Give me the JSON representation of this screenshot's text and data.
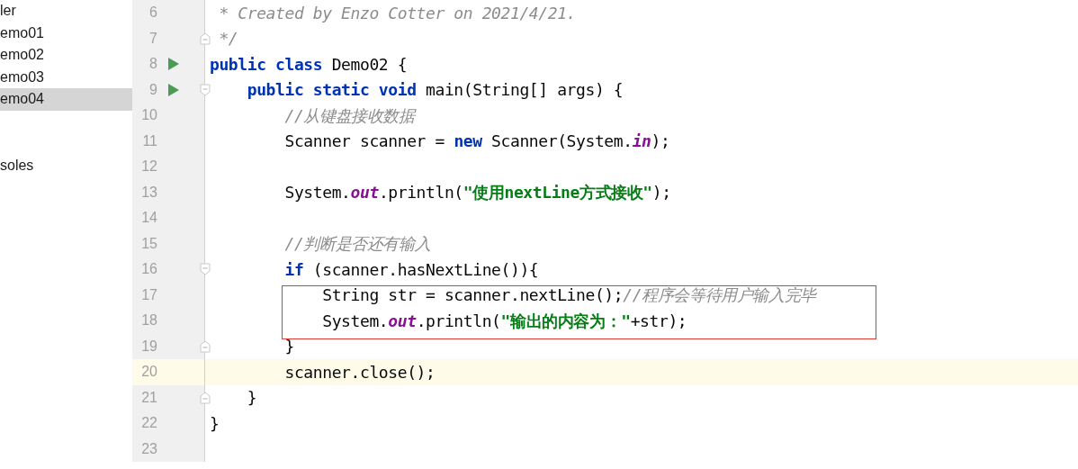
{
  "sidebar": {
    "items": [
      {
        "label": "ler",
        "selected": false
      },
      {
        "label": "emo01",
        "selected": false
      },
      {
        "label": "emo02",
        "selected": false
      },
      {
        "label": "emo03",
        "selected": false
      },
      {
        "label": "emo04",
        "selected": true
      },
      {
        "selected": false
      },
      {
        "selected": false
      },
      {
        "label": "soles",
        "selected": false
      }
    ]
  },
  "editor": {
    "lines": [
      {
        "number": "6",
        "run": false,
        "fold_start": false,
        "fold_end": false,
        "current": false,
        "boxed": false,
        "segments": [
          {
            "kind": "comment",
            "text": " * Created by Enzo Cotter on 2021/4/21."
          }
        ]
      },
      {
        "number": "7",
        "run": false,
        "fold_start": false,
        "fold_end": true,
        "current": false,
        "boxed": false,
        "segments": [
          {
            "kind": "comment",
            "text": " */"
          }
        ]
      },
      {
        "number": "8",
        "run": true,
        "fold_start": false,
        "fold_end": false,
        "current": false,
        "boxed": false,
        "segments": [
          {
            "kind": "keyword",
            "text": "public class"
          },
          {
            "kind": "plain",
            "text": " Demo02 {"
          }
        ]
      },
      {
        "number": "9",
        "run": true,
        "fold_start": true,
        "fold_end": false,
        "current": false,
        "boxed": false,
        "segments": [
          {
            "kind": "keyword",
            "text": "    public static void"
          },
          {
            "kind": "plain",
            "text": " main(String[] args) {"
          }
        ]
      },
      {
        "number": "10",
        "run": false,
        "fold_start": false,
        "fold_end": false,
        "current": false,
        "boxed": false,
        "segments": [
          {
            "kind": "comment",
            "text": "        //从键盘接收数据"
          }
        ]
      },
      {
        "number": "11",
        "run": false,
        "fold_start": false,
        "fold_end": false,
        "current": false,
        "boxed": false,
        "segments": [
          {
            "kind": "plain",
            "text": "        Scanner scanner = "
          },
          {
            "kind": "keyword",
            "text": "new"
          },
          {
            "kind": "plain",
            "text": " Scanner(System."
          },
          {
            "kind": "field",
            "text": "in"
          },
          {
            "kind": "plain",
            "text": ");"
          }
        ]
      },
      {
        "number": "12",
        "run": false,
        "fold_start": false,
        "fold_end": false,
        "current": false,
        "boxed": false
      },
      {
        "number": "13",
        "run": false,
        "fold_start": false,
        "fold_end": false,
        "current": false,
        "boxed": false,
        "segments": [
          {
            "kind": "plain",
            "text": "        System."
          },
          {
            "kind": "field",
            "text": "out"
          },
          {
            "kind": "plain",
            "text": ".println("
          },
          {
            "kind": "string",
            "text": "\"使用nextLine方式接收\""
          },
          {
            "kind": "plain",
            "text": ");"
          }
        ]
      },
      {
        "number": "14",
        "run": false,
        "fold_start": false,
        "fold_end": false,
        "current": false,
        "boxed": false
      },
      {
        "number": "15",
        "run": false,
        "fold_start": false,
        "fold_end": false,
        "current": false,
        "boxed": false,
        "segments": [
          {
            "kind": "comment",
            "text": "        //判断是否还有输入"
          }
        ]
      },
      {
        "number": "16",
        "run": false,
        "fold_start": true,
        "fold_end": false,
        "current": false,
        "boxed": false,
        "segments": [
          {
            "kind": "keyword",
            "text": "        if"
          },
          {
            "kind": "plain",
            "text": " (scanner.hasNextLine()){"
          }
        ]
      },
      {
        "number": "17",
        "run": false,
        "fold_start": false,
        "fold_end": false,
        "current": false,
        "boxed": true,
        "segments": [
          {
            "kind": "plain",
            "text": "            String str = scanner.nextLine();"
          },
          {
            "kind": "comment",
            "text": "//程序会等待用户输入完毕"
          }
        ]
      },
      {
        "number": "18",
        "run": false,
        "fold_start": false,
        "fold_end": false,
        "current": false,
        "boxed": true,
        "segments": [
          {
            "kind": "plain",
            "text": "            System."
          },
          {
            "kind": "field",
            "text": "out"
          },
          {
            "kind": "plain",
            "text": ".println("
          },
          {
            "kind": "string",
            "text": "\"输出的内容为：\""
          },
          {
            "kind": "plain",
            "text": "+str);"
          }
        ]
      },
      {
        "number": "19",
        "run": false,
        "fold_start": false,
        "fold_end": true,
        "current": false,
        "boxed": false,
        "segments": [
          {
            "kind": "plain",
            "text": "        }"
          }
        ]
      },
      {
        "number": "20",
        "run": false,
        "fold_start": false,
        "fold_end": false,
        "current": true,
        "boxed": false,
        "segments": [
          {
            "kind": "plain",
            "text": "        scanner.close();"
          }
        ]
      },
      {
        "number": "21",
        "run": false,
        "fold_start": false,
        "fold_end": true,
        "current": false,
        "boxed": false,
        "segments": [
          {
            "kind": "plain",
            "text": "    }"
          }
        ]
      },
      {
        "number": "22",
        "run": false,
        "fold_start": false,
        "fold_end": false,
        "current": false,
        "boxed": false,
        "segments": [
          {
            "kind": "plain",
            "text": "}"
          }
        ]
      },
      {
        "number": "23",
        "run": false,
        "fold_start": false,
        "fold_end": false,
        "current": false,
        "boxed": false
      }
    ]
  }
}
